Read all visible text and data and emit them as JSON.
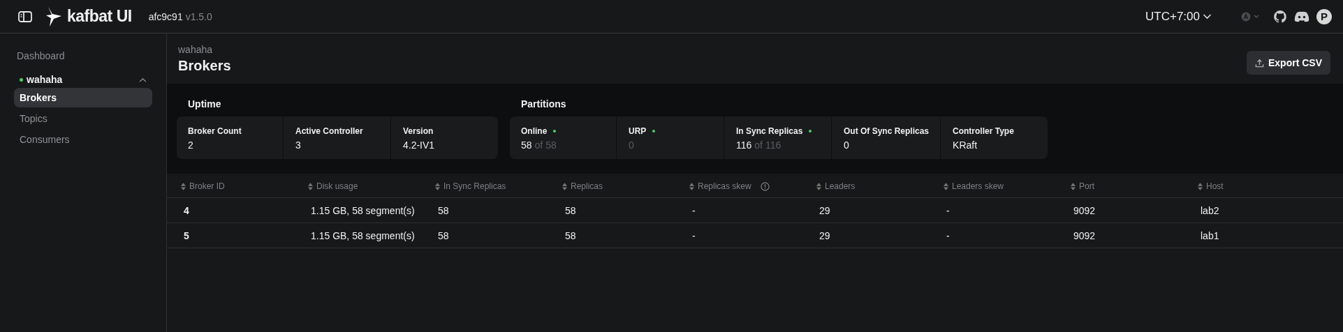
{
  "header": {
    "brand": "kafbat UI",
    "commit": "afc9c91",
    "version": "v1.5.0",
    "timezone": "UTC+7:00",
    "avatar_letter": "P"
  },
  "sidebar": {
    "dashboard": "Dashboard",
    "cluster": {
      "name": "wahaha",
      "online": true,
      "expanded": true
    },
    "items": [
      {
        "label": "Brokers",
        "selected": true
      },
      {
        "label": "Topics",
        "selected": false
      },
      {
        "label": "Consumers",
        "selected": false
      }
    ]
  },
  "page": {
    "breadcrumb": "wahaha",
    "title": "Brokers",
    "export_button": "Export CSV"
  },
  "stat_groups": [
    {
      "title": "Uptime",
      "cards": [
        {
          "label": "Broker Count",
          "value": "2",
          "status_dot": false,
          "muted": false
        },
        {
          "label": "Active Controller",
          "value": "3",
          "status_dot": false,
          "muted": false
        },
        {
          "label": "Version",
          "value": "4.2-IV1",
          "status_dot": false,
          "muted": false
        }
      ]
    },
    {
      "title": "Partitions",
      "cards": [
        {
          "label": "Online",
          "value": "58",
          "of": "of 58",
          "status_dot": true,
          "muted": false
        },
        {
          "label": "URP",
          "value": "0",
          "status_dot": true,
          "muted": true
        },
        {
          "label": "In Sync Replicas",
          "value": "116",
          "of": "of 116",
          "status_dot": true,
          "muted": false
        },
        {
          "label": "Out Of Sync Replicas",
          "value": "0",
          "status_dot": false,
          "muted": false
        },
        {
          "label": "Controller Type",
          "value": "KRaft",
          "status_dot": false,
          "muted": false
        }
      ]
    }
  ],
  "table": {
    "columns": [
      {
        "label": "Broker ID",
        "info": false
      },
      {
        "label": "Disk usage",
        "info": false
      },
      {
        "label": "In Sync Replicas",
        "info": false
      },
      {
        "label": "Replicas",
        "info": false
      },
      {
        "label": "Replicas skew",
        "info": true
      },
      {
        "label": "Leaders",
        "info": false
      },
      {
        "label": "Leaders skew",
        "info": false
      },
      {
        "label": "Port",
        "info": false
      },
      {
        "label": "Host",
        "info": false
      }
    ],
    "rows": [
      [
        "4",
        "1.15 GB, 58 segment(s)",
        "58",
        "58",
        "-",
        "29",
        "-",
        "9092",
        "lab2"
      ],
      [
        "5",
        "1.15 GB, 58 segment(s)",
        "58",
        "58",
        "-",
        "29",
        "-",
        "9092",
        "lab1"
      ]
    ]
  }
}
